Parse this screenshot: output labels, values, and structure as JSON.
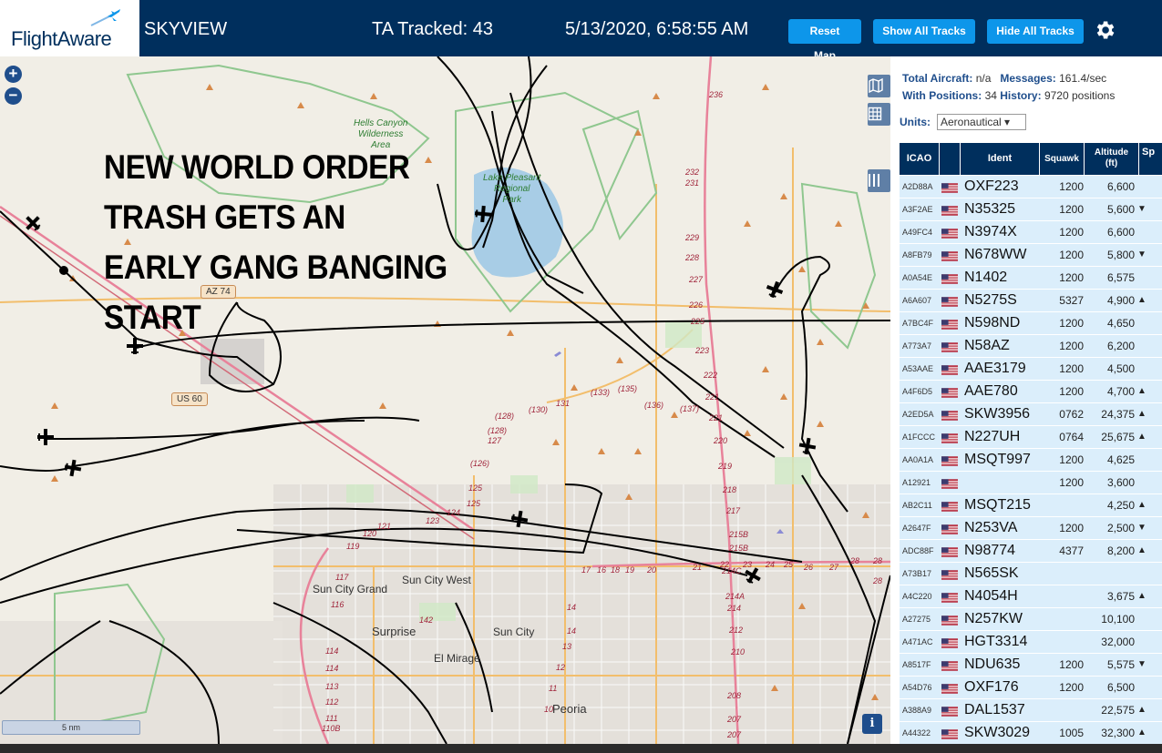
{
  "header": {
    "logo_text": "FlightAware",
    "app_title": "SKYVIEW",
    "ta_tracked": "TA Tracked: 43",
    "clock": "5/13/2020, 6:58:55 AM",
    "reset_map_label": "Reset Map",
    "show_all_label": "Show All Tracks",
    "hide_all_label": "Hide All Tracks",
    "settings_icon": "gear-icon"
  },
  "colors": {
    "header_bg": "#002f5d",
    "button_bg": "#0d96ea",
    "table_header_bg": "#002f5d",
    "row_bg": "#dbeefb",
    "map_bg": "#f1eee6",
    "park_green": "#8fc78f",
    "road_pink": "#e8829a",
    "water_blue": "#a8cde6"
  },
  "map": {
    "overlay_text": [
      "NEW WORLD ORDER",
      "TRASH GETS AN",
      "EARLY GANG BANGING START"
    ],
    "zoom_in": "+",
    "zoom_out": "−",
    "info_button": "i",
    "scale_label": "5 nm",
    "places": {
      "hells_canyon_1": "Hells Canyon",
      "hells_canyon_2": "Wilderness",
      "hells_canyon_3": "Area",
      "lake_1": "Lake Pleasant",
      "lake_2": "Regional",
      "lake_3": "Park",
      "sun_city_grand": "Sun City Grand",
      "sun_city_west": "Sun City West",
      "sun_city": "Sun City",
      "surprise": "Surprise",
      "el_mirage": "El Mirage",
      "peoria": "Peoria"
    },
    "shields": {
      "az74": "AZ 74",
      "us60": "US 60"
    },
    "road_numbers": {
      "r236": "236",
      "r232": "232",
      "r231": "231",
      "r229": "229",
      "r228": "228",
      "r227": "227",
      "r226": "226",
      "r225": "225",
      "r223": "223",
      "r222": "222",
      "r221a": "221",
      "r221b": "221",
      "r220": "220",
      "r219": "219",
      "r218": "218",
      "r217": "217",
      "r215b": "215B",
      "r215b2": "215B",
      "r214c": "214C",
      "r214a": "214A",
      "r214": "214",
      "r212": "212",
      "r210": "210",
      "r208": "208",
      "r207a": "207",
      "r207b": "207",
      "r135": "(135)",
      "r133": "(133)",
      "r136": "(136)",
      "r137": "(137)",
      "r131": "131",
      "r130": "(130)",
      "r128a": "(128)",
      "r128b": "(128)",
      "r127": "127",
      "r126": "(126)",
      "r125a": "125",
      "r125b": "125",
      "r124": "124",
      "r123": "123",
      "r121": "121",
      "r120": "120",
      "r119": "119",
      "r117": "117",
      "r116": "116",
      "r114a": "114",
      "r114b": "114",
      "r113": "113",
      "r112": "112",
      "r111": "111",
      "r110b": "110B",
      "r142": "142",
      "r14a": "14",
      "r14b": "14",
      "r13": "13",
      "r12": "12",
      "r11": "11",
      "r10": "10",
      "r17": "17",
      "r16": "16",
      "r18": "18",
      "r19": "19",
      "r20": "20",
      "r21": "21",
      "r22": "22",
      "r23": "23",
      "r24": "24",
      "r25": "25",
      "r26": "26",
      "r27": "27",
      "r28a": "28",
      "r28b": "28",
      "r28c": "28"
    }
  },
  "panel": {
    "total_aircraft_label": "Total Aircraft:",
    "total_aircraft_value": "n/a",
    "messages_label": "Messages:",
    "messages_value": "161.4/sec",
    "with_positions_label": "With Positions:",
    "with_positions_value": "34",
    "history_label": "History:",
    "history_value": "9720 positions",
    "units_label": "Units:",
    "units_value": "Aeronautical ▾",
    "columns": {
      "icao": "ICAO",
      "ident": "Ident",
      "squawk": "Squawk",
      "alt_1": "Altitude",
      "alt_2": "(ft)",
      "sp": "Sp"
    },
    "rows": [
      {
        "icao": "A2D88A",
        "ident": "OXF223",
        "squawk": "1200",
        "altitude": "6,600",
        "trend": ""
      },
      {
        "icao": "A3F2AE",
        "ident": "N35325",
        "squawk": "1200",
        "altitude": "5,600",
        "trend": "▼"
      },
      {
        "icao": "A49FC4",
        "ident": "N3974X",
        "squawk": "1200",
        "altitude": "6,600",
        "trend": ""
      },
      {
        "icao": "A8FB79",
        "ident": "N678WW",
        "squawk": "1200",
        "altitude": "5,800",
        "trend": "▼"
      },
      {
        "icao": "A0A54E",
        "ident": "N1402",
        "squawk": "1200",
        "altitude": "6,575",
        "trend": ""
      },
      {
        "icao": "A6A607",
        "ident": "N5275S",
        "squawk": "5327",
        "altitude": "4,900",
        "trend": "▲"
      },
      {
        "icao": "A7BC4F",
        "ident": "N598ND",
        "squawk": "1200",
        "altitude": "4,650",
        "trend": ""
      },
      {
        "icao": "A773A7",
        "ident": "N58AZ",
        "squawk": "1200",
        "altitude": "6,200",
        "trend": ""
      },
      {
        "icao": "A53AAE",
        "ident": "AAE3179",
        "squawk": "1200",
        "altitude": "4,500",
        "trend": ""
      },
      {
        "icao": "A4F6D5",
        "ident": "AAE780",
        "squawk": "1200",
        "altitude": "4,700",
        "trend": "▲"
      },
      {
        "icao": "A2ED5A",
        "ident": "SKW3956",
        "squawk": "0762",
        "altitude": "24,375",
        "trend": "▲"
      },
      {
        "icao": "A1FCCC",
        "ident": "N227UH",
        "squawk": "0764",
        "altitude": "25,675",
        "trend": "▲"
      },
      {
        "icao": "AA0A1A",
        "ident": "MSQT997",
        "squawk": "1200",
        "altitude": "4,625",
        "trend": ""
      },
      {
        "icao": "A12921",
        "ident": "",
        "squawk": "1200",
        "altitude": "3,600",
        "trend": ""
      },
      {
        "icao": "AB2C11",
        "ident": "MSQT215",
        "squawk": "",
        "altitude": "4,250",
        "trend": "▲"
      },
      {
        "icao": "A2647F",
        "ident": "N253VA",
        "squawk": "1200",
        "altitude": "2,500",
        "trend": "▼"
      },
      {
        "icao": "ADC88F",
        "ident": "N98774",
        "squawk": "4377",
        "altitude": "8,200",
        "trend": "▲"
      },
      {
        "icao": "A73B17",
        "ident": "N565SK",
        "squawk": "",
        "altitude": "",
        "trend": ""
      },
      {
        "icao": "A4C220",
        "ident": "N4054H",
        "squawk": "",
        "altitude": "3,675",
        "trend": "▲"
      },
      {
        "icao": "A27275",
        "ident": "N257KW",
        "squawk": "",
        "altitude": "10,100",
        "trend": ""
      },
      {
        "icao": "A471AC",
        "ident": "HGT3314",
        "squawk": "",
        "altitude": "32,000",
        "trend": ""
      },
      {
        "icao": "A8517F",
        "ident": "NDU635",
        "squawk": "1200",
        "altitude": "5,575",
        "trend": "▼"
      },
      {
        "icao": "A54D76",
        "ident": "OXF176",
        "squawk": "1200",
        "altitude": "6,500",
        "trend": ""
      },
      {
        "icao": "A388A9",
        "ident": "DAL1537",
        "squawk": "",
        "altitude": "22,575",
        "trend": "▲"
      },
      {
        "icao": "A44322",
        "ident": "SKW3029",
        "squawk": "1005",
        "altitude": "32,300",
        "trend": "▲"
      }
    ]
  }
}
